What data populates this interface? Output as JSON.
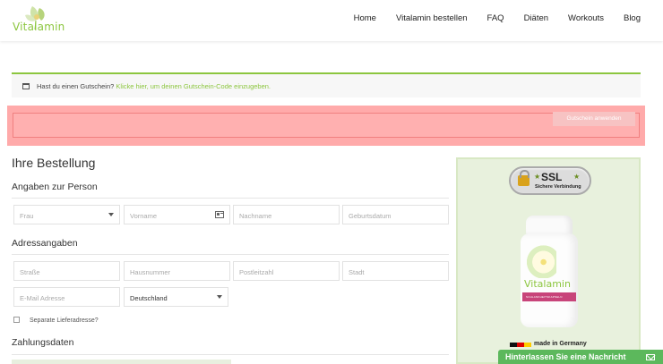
{
  "header": {
    "logo_text": "Vitalamin",
    "nav": [
      "Home",
      "Vitalamin bestellen",
      "FAQ",
      "Diäten",
      "Workouts",
      "Blog"
    ]
  },
  "coupon_notice": {
    "text": "Hast du einen Gutschein?",
    "link": "Klicke hier, um deinen Gutschein-Code einzugeben."
  },
  "coupon_form": {
    "button_label": "Gutschein anwenden"
  },
  "order": {
    "title": "Ihre Bestellung",
    "person": {
      "heading": "Angaben zur Person",
      "salutation": "Frau",
      "first_name_placeholder": "Vorname",
      "last_name_placeholder": "Nachname",
      "birthdate_placeholder": "Geburtsdatum"
    },
    "address": {
      "heading": "Adressangaben",
      "street_placeholder": "Straße",
      "house_number_placeholder": "Hausnummer",
      "zip_placeholder": "Postleitzahl",
      "city_placeholder": "Stadt",
      "email_placeholder": "E-Mail Adresse",
      "country": "Deutschland",
      "separate_delivery_label": "Separate Lieferadresse?"
    },
    "payment": {
      "heading": "Zahlungsdaten"
    }
  },
  "sidebar": {
    "ssl_title": "SSL",
    "ssl_subtitle": "Sichere Verbindung",
    "product_brand": "Vitalamin",
    "product_band": "SCHLANKHEITSKAPSELN",
    "made_in": "made in Germany"
  },
  "chat": {
    "label": "Hinterlassen Sie eine Nachricht"
  },
  "colors": {
    "accent": "#8cc63f",
    "highlight": "#ffaaaa",
    "chat": "#5cb85c"
  }
}
